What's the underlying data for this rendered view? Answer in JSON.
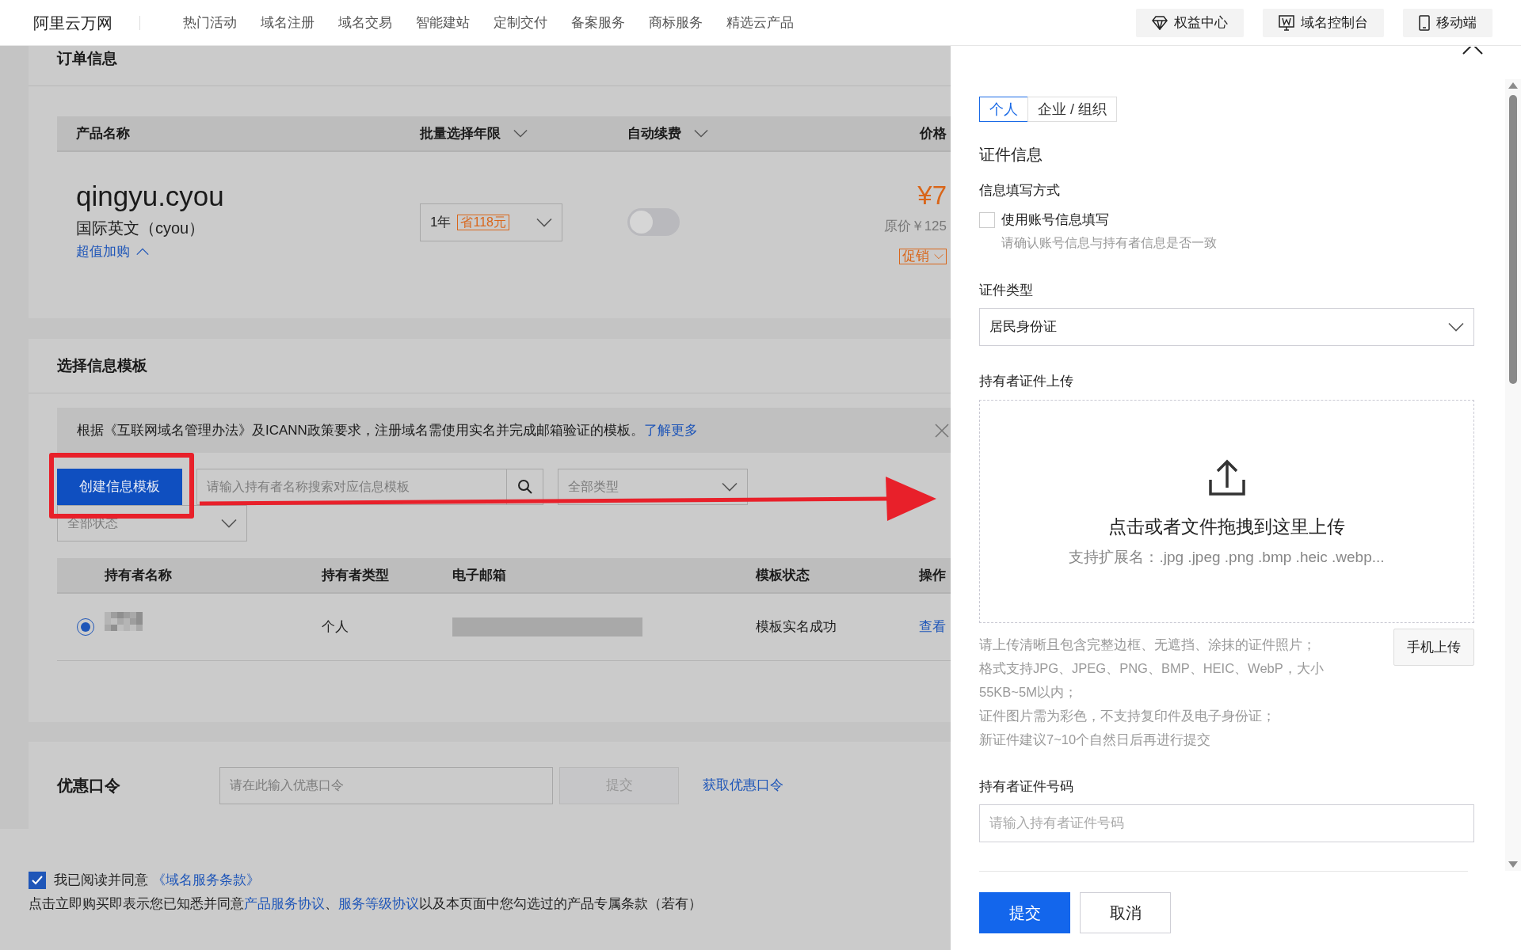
{
  "top_nav": {
    "logo": "阿里云万网",
    "links": [
      "热门活动",
      "域名注册",
      "域名交易",
      "智能建站",
      "定制交付",
      "备案服务",
      "商标服务",
      "精选云产品"
    ],
    "actions": [
      {
        "label": "权益中心",
        "kind": "diamond"
      },
      {
        "label": "域名控制台",
        "kind": "console"
      },
      {
        "label": "移动端",
        "kind": "phone"
      }
    ]
  },
  "order": {
    "title": "订单信息",
    "columns": [
      {
        "label": "产品名称",
        "dropdown": false
      },
      {
        "label": "批量选择年限",
        "dropdown": true
      },
      {
        "label": "自动续费",
        "dropdown": true
      },
      {
        "label": "价格",
        "dropdown": false
      }
    ],
    "item": {
      "domain": "qingyu.cyou",
      "suffix_type": "国际英文（cyou）",
      "addon_link": "超值加购",
      "term": "1年",
      "saving": "省118元",
      "auto_renew": false,
      "price": "¥7",
      "original_price": "原价￥125",
      "promo": "促销"
    }
  },
  "templates": {
    "title": "选择信息模板",
    "notice": {
      "text": "根据《互联网域名管理办法》及ICANN政策要求，注册域名需使用实名并完成邮箱验证的模板。",
      "link": "了解更多"
    },
    "create_button": "创建信息模板",
    "search": {
      "placeholder": "请输入持有者名称搜索对应信息模板"
    },
    "type_filter": {
      "placeholder": "全部类型"
    },
    "status_filter": {
      "placeholder": "全部状态"
    },
    "columns": [
      "持有者名称",
      "持有者类型",
      "电子邮箱",
      "模板状态",
      "操作"
    ],
    "rows": [
      {
        "selected": true,
        "holder_type": "个人",
        "status": "模板实名成功",
        "action": "查看"
      }
    ]
  },
  "coupon": {
    "label": "优惠口令",
    "placeholder": "请在此输入优惠口令",
    "submit": {
      "label": "提交",
      "disabled": true
    },
    "link": "获取优惠口令"
  },
  "agreement": {
    "checked": true,
    "text": "我已阅读并同意",
    "terms_link": "《域名服务条款》",
    "notice_parts": [
      {
        "kind": "text",
        "text": "点击立即购买即表示您已知悉并同意"
      },
      {
        "kind": "link",
        "text": "产品服务协议"
      },
      {
        "kind": "text",
        "text": "、"
      },
      {
        "kind": "link",
        "text": "服务等级协议"
      },
      {
        "kind": "text",
        "text": "以及本页面中您勾选过的产品专属条款（若有）"
      }
    ]
  },
  "drawer": {
    "tabs": [
      {
        "label": "个人",
        "selected": true
      },
      {
        "label": "企业 / 组织",
        "selected": false
      }
    ],
    "section_title": "证件信息",
    "fill_method": {
      "label": "信息填写方式",
      "option": "使用账号信息填写",
      "checked": false,
      "hint": "请确认账号信息与持有者信息是否一致"
    },
    "id_type": {
      "label": "证件类型",
      "value": "居民身份证"
    },
    "upload": {
      "label": "持有者证件上传",
      "prompt": "点击或者文件拖拽到这里上传",
      "extensions": "支持扩展名：.jpg .jpeg .png .bmp .heic .webp...",
      "rules": [
        "请上传清晰且包含完整边框、无遮挡、涂抹的证件照片；",
        "格式支持JPG、JPEG、PNG、BMP、HEIC、WebP，大小55KB~5M以内；",
        "证件图片需为彩色，不支持复印件及电子身份证；",
        "新证件建议7~10个自然日后再进行提交"
      ],
      "mobile_button": "手机上传"
    },
    "id_number": {
      "label": "持有者证件号码",
      "placeholder": "请输入持有者证件号码"
    },
    "buttons": [
      {
        "label": "提交",
        "kind": "primary"
      },
      {
        "label": "取消",
        "kind": "secondary"
      }
    ]
  }
}
